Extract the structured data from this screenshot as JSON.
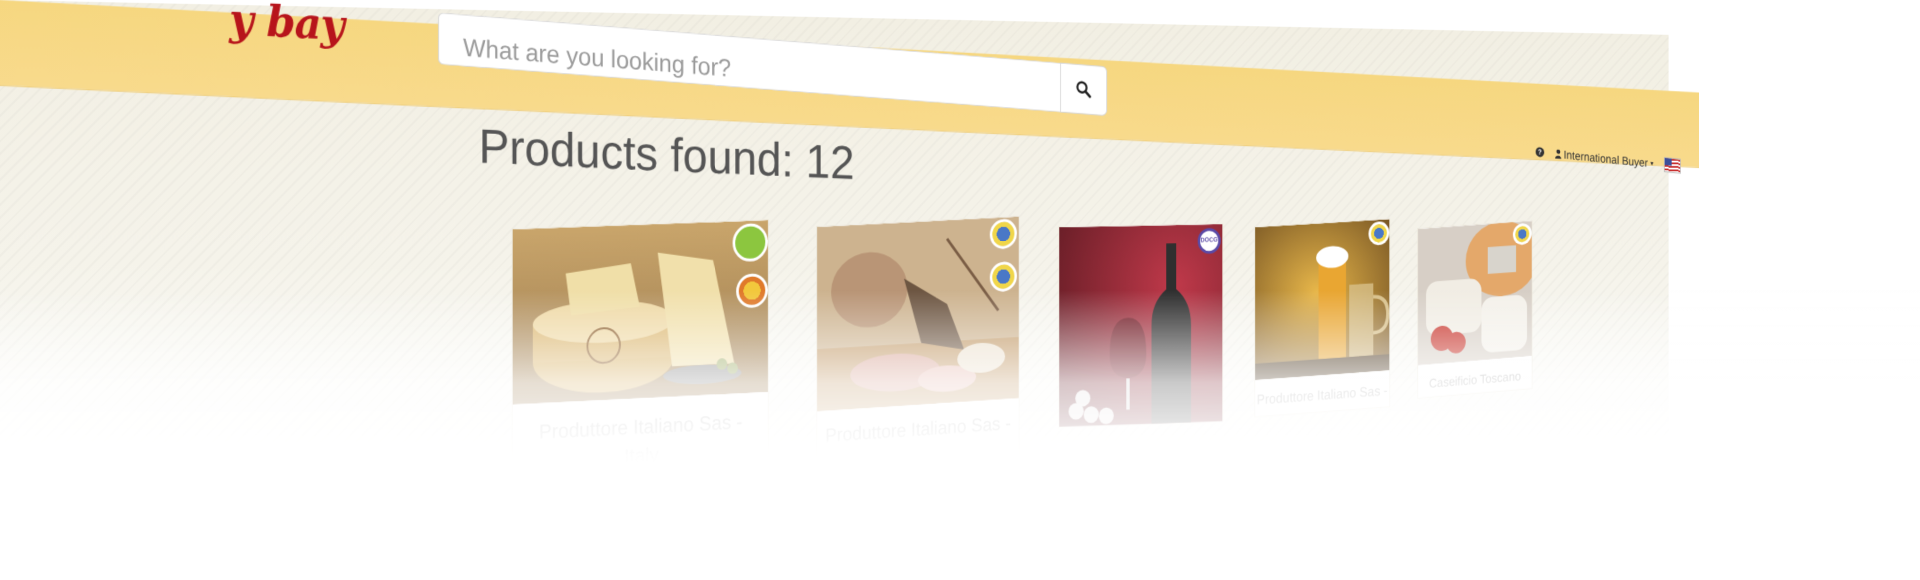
{
  "header": {
    "logo_text": "y bay",
    "search": {
      "placeholder": "What are you looking for?"
    },
    "help_icon": "?",
    "buyer_menu": {
      "label": "International Buyer",
      "caret": "▾"
    },
    "flag_icon": "us-flag-icon"
  },
  "main": {
    "title": "Products found: 12",
    "products": [
      {
        "label": "Produttore Italiano Sas - Italy",
        "image": "parmesan-cheese-image",
        "badges": [
          "organic-eu-badge",
          "dop-badge"
        ]
      },
      {
        "label": "Produttore Italiano Sas -",
        "image": "cured-meats-image",
        "badges": [
          "igp-badge",
          "igp-badge"
        ]
      },
      {
        "label": "",
        "image": "red-wine-image",
        "badges": [
          "docg-badge"
        ],
        "badge_text": "DOCG"
      },
      {
        "label": "Produttore Italiano Sas -",
        "image": "beer-image",
        "badges": [
          "igp-badge"
        ]
      },
      {
        "label": "Caseificio Toscano Snc -",
        "image": "pecorino-cheese-image",
        "badges": [
          "igp-badge"
        ]
      }
    ]
  },
  "colors": {
    "header_bg": "#f6d780",
    "logo_red": "#b7141b",
    "label_gray": "#a7a7a7",
    "title_gray": "#555555"
  }
}
